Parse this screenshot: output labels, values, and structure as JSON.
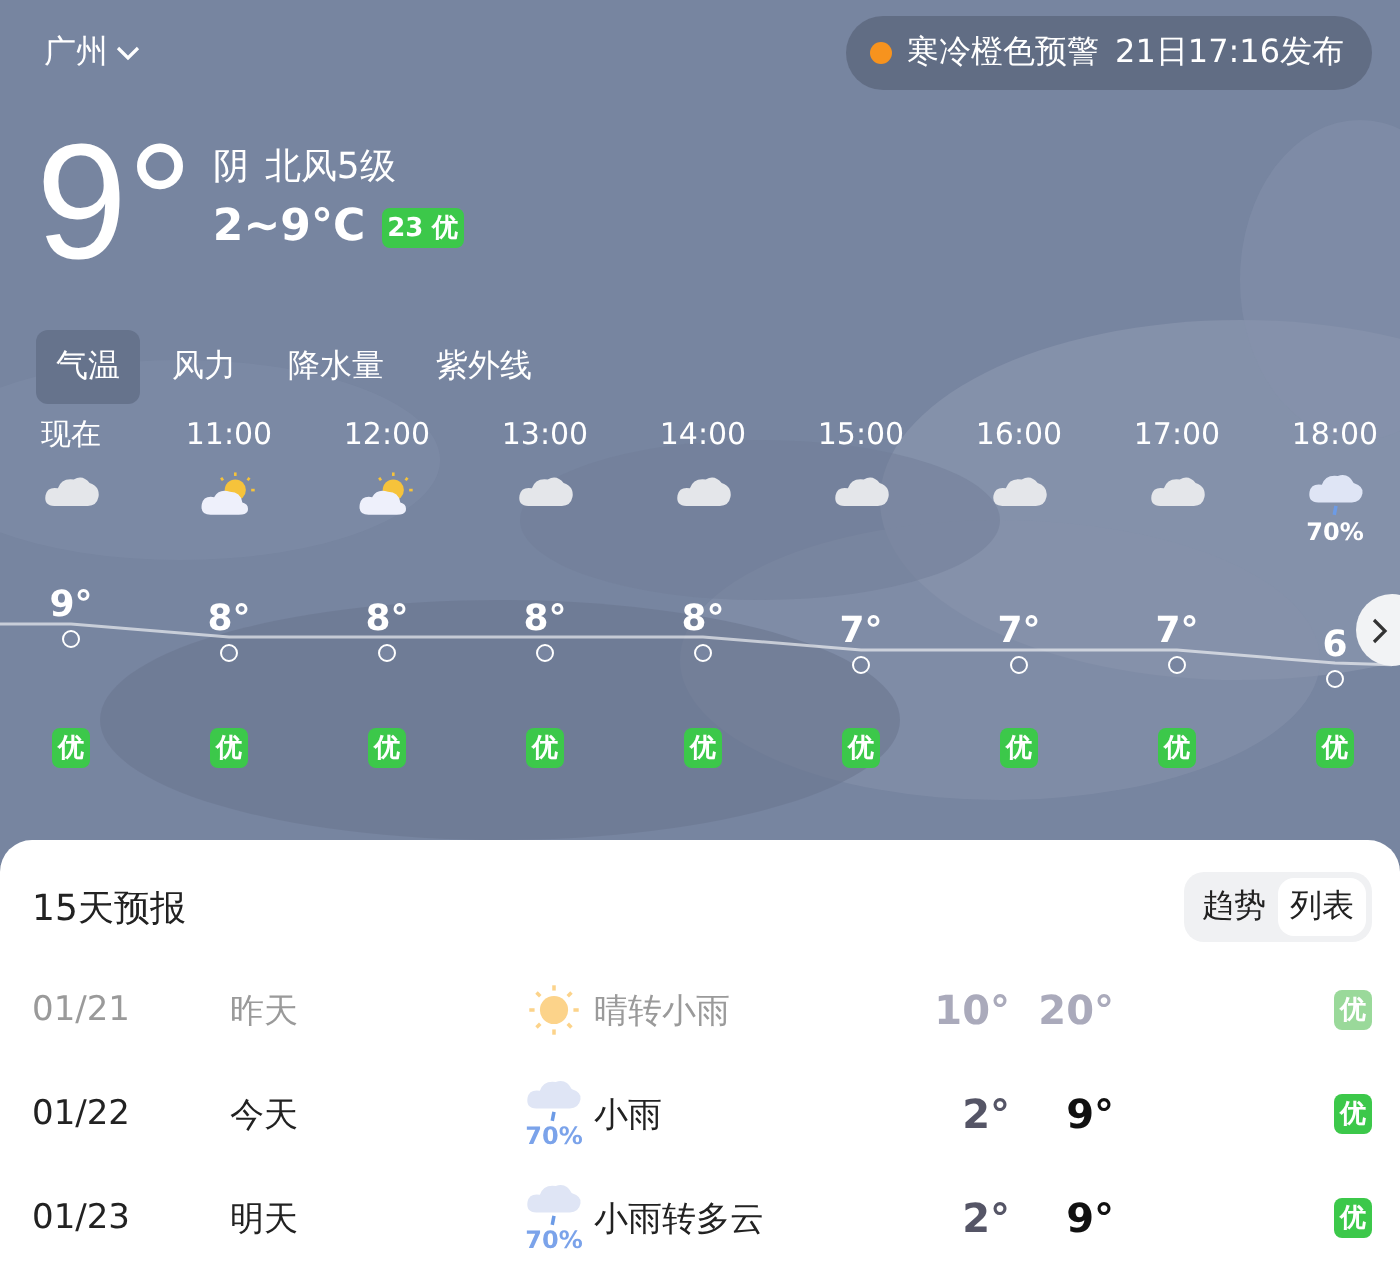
{
  "location": {
    "city": "广州"
  },
  "alert": {
    "title": "寒冷橙色预警",
    "time": "21日17:16发布",
    "color": "#f7931e"
  },
  "current": {
    "temp": "9°",
    "condition": "阴",
    "wind": "北风5级",
    "range": "2~9°C",
    "aqi": "23 优"
  },
  "tabs": [
    {
      "label": "气温",
      "selected": true
    },
    {
      "label": "风力",
      "selected": false
    },
    {
      "label": "降水量",
      "selected": false
    },
    {
      "label": "紫外线",
      "selected": false
    }
  ],
  "hourly": [
    {
      "time": "现在",
      "kind": "cloudy",
      "temp": "9°",
      "aqi": "优"
    },
    {
      "time": "11:00",
      "kind": "partly",
      "temp": "8°",
      "aqi": "优"
    },
    {
      "time": "12:00",
      "kind": "partly",
      "temp": "8°",
      "aqi": "优"
    },
    {
      "time": "13:00",
      "kind": "cloudy",
      "temp": "8°",
      "aqi": "优"
    },
    {
      "time": "14:00",
      "kind": "cloudy",
      "temp": "8°",
      "aqi": "优"
    },
    {
      "time": "15:00",
      "kind": "cloudy",
      "temp": "7°",
      "aqi": "优"
    },
    {
      "time": "16:00",
      "kind": "cloudy",
      "temp": "7°",
      "aqi": "优"
    },
    {
      "time": "17:00",
      "kind": "cloudy",
      "temp": "7°",
      "aqi": "优"
    },
    {
      "time": "18:00",
      "kind": "rain",
      "pop": "70%",
      "temp": "6",
      "aqi": "优"
    }
  ],
  "forecast": {
    "title": "15天预报",
    "views": [
      {
        "label": "趋势",
        "selected": false
      },
      {
        "label": "列表",
        "selected": true
      }
    ],
    "days": [
      {
        "date": "01/21",
        "day": "昨天",
        "kind": "sunny",
        "condition": "晴转小雨",
        "low": "10°",
        "high": "20°",
        "aqi": "优",
        "past": true
      },
      {
        "date": "01/22",
        "day": "今天",
        "kind": "rain",
        "pop": "70%",
        "condition": "小雨",
        "low": "2°",
        "high": "9°",
        "aqi": "优",
        "past": false
      },
      {
        "date": "01/23",
        "day": "明天",
        "kind": "rain",
        "pop": "70%",
        "condition": "小雨转多云",
        "low": "2°",
        "high": "9°",
        "aqi": "优",
        "past": false
      }
    ]
  }
}
